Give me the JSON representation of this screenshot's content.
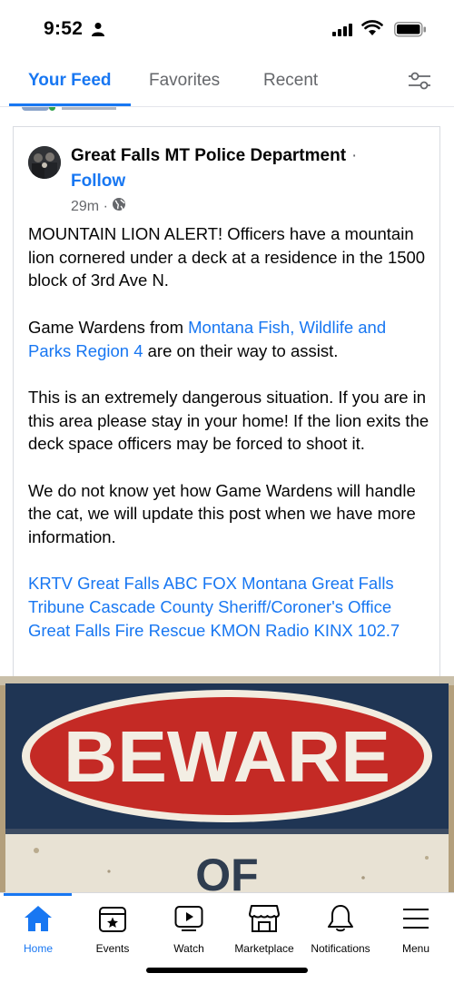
{
  "status_bar": {
    "time": "9:52"
  },
  "tabs": [
    {
      "label": "Your Feed",
      "active": true
    },
    {
      "label": "Favorites",
      "active": false
    },
    {
      "label": "Recent",
      "active": false
    }
  ],
  "post": {
    "author": "Great Falls MT Police Department",
    "separator": "·",
    "follow_label": "Follow",
    "time": "29m ·",
    "privacy_icon": "globe-icon",
    "paragraph1": "MOUNTAIN LION ALERT! Officers have a mountain lion cornered under a deck at a residence in the 1500 block of 3rd Ave N.",
    "paragraph2_before": "Game Wardens from ",
    "paragraph2_link": "Montana Fish, Wildlife and Parks Region 4",
    "paragraph2_after": " are on their way to assist.",
    "paragraph3": "This is an extremely dangerous situation. If you are in this area please stay in your home! If the lion exits the deck space officers may be forced to shoot it.",
    "paragraph4": "We do not know yet how Game Wardens will handle the cat, we will update this post when we have more information.",
    "tags": "KRTV Great Falls ABC FOX Montana Great Falls Tribune Cascade County Sheriff/Coroner's Office Great Falls Fire Rescue KMON Radio KINX 102.7",
    "image": {
      "sign_word": "BEWARE",
      "sign_word2": "OF"
    }
  },
  "bottom_nav": [
    {
      "label": "Home",
      "icon": "home-icon",
      "active": true
    },
    {
      "label": "Events",
      "icon": "calendar-star-icon",
      "active": false
    },
    {
      "label": "Watch",
      "icon": "play-video-icon",
      "active": false
    },
    {
      "label": "Marketplace",
      "icon": "shop-icon",
      "active": false
    },
    {
      "label": "Notifications",
      "icon": "bell-icon",
      "active": false
    },
    {
      "label": "Menu",
      "icon": "hamburger-icon",
      "active": false
    }
  ],
  "colors": {
    "accent": "#1877f2",
    "text": "#050505",
    "secondary": "#65676b",
    "sign_red": "#c42a25",
    "sign_navy": "#1f3554"
  }
}
